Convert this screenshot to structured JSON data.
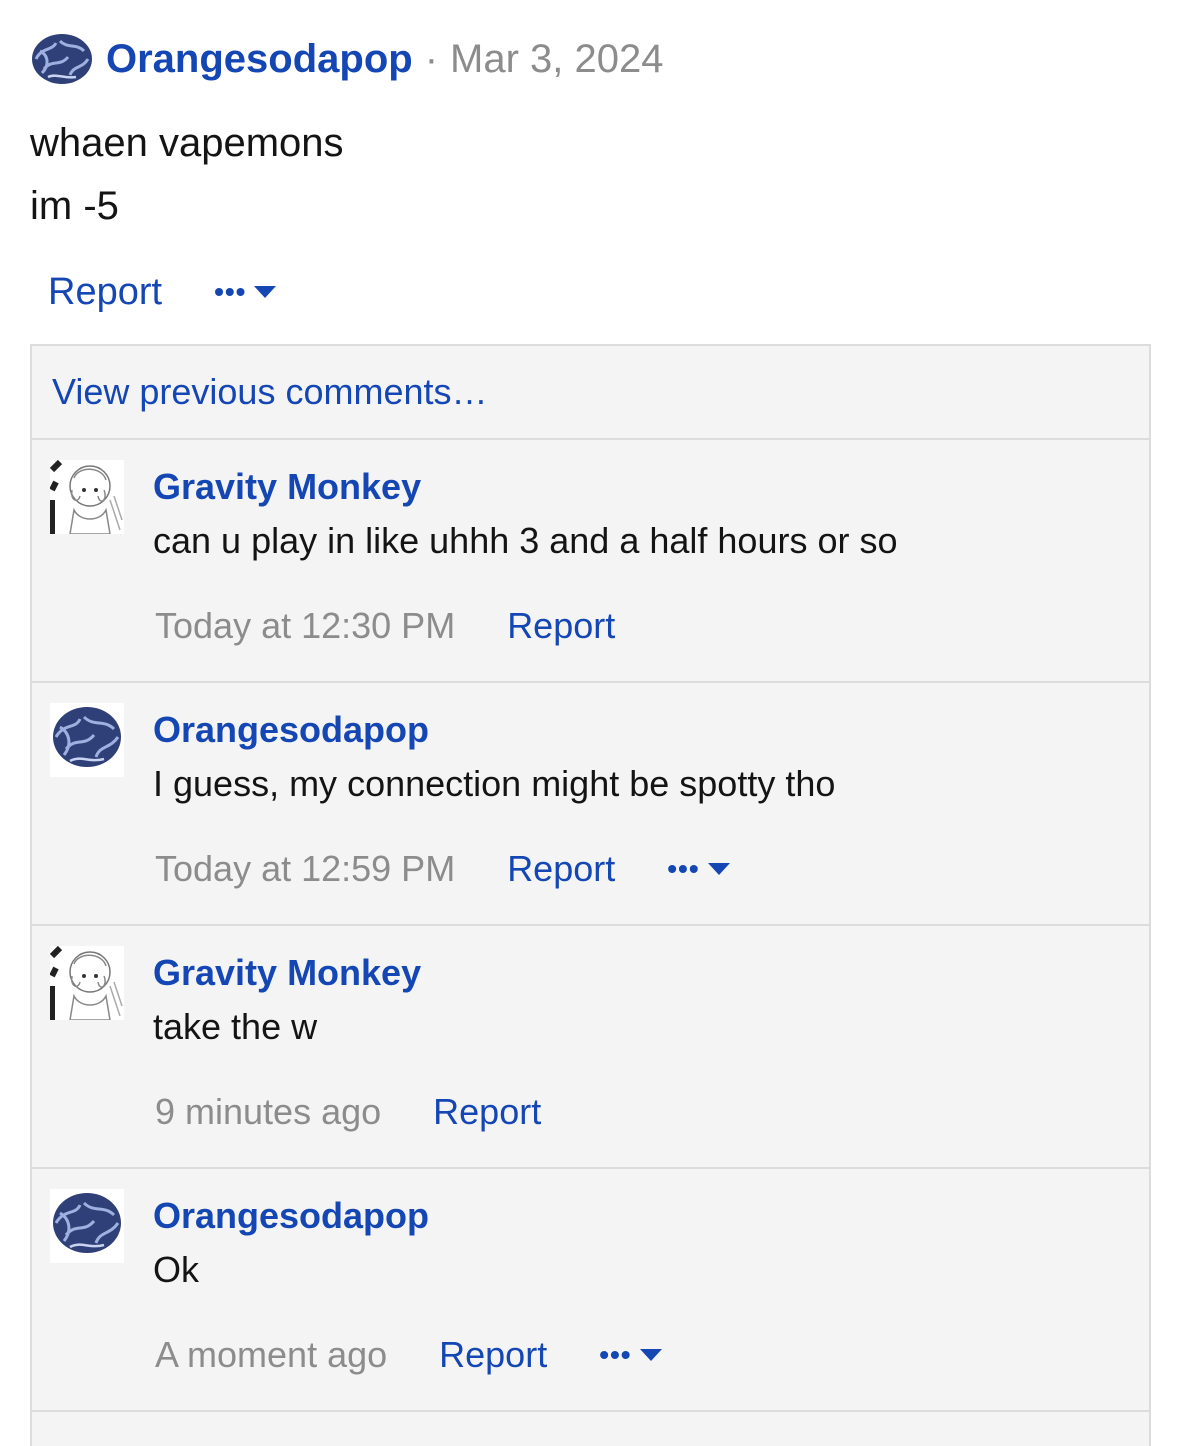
{
  "post": {
    "author": "Orangesodapop",
    "separator": "·",
    "date": "Mar 3, 2024",
    "body_lines": [
      "whaen vapemons",
      "im -5"
    ],
    "report_label": "Report",
    "more_label": "•••"
  },
  "comments_block": {
    "view_previous": "View previous comments…",
    "items": [
      {
        "author": "Gravity Monkey",
        "text": "can u play in like uhhh 3 and a half hours or so",
        "time": "Today at 12:30 PM",
        "report": "Report",
        "avatar": "girl-sketch"
      },
      {
        "author": "Orangesodapop",
        "text": "I guess, my connection might be spotty tho",
        "time": "Today at 12:59 PM",
        "report": "Report",
        "more": "•••",
        "avatar": "brain"
      },
      {
        "author": "Gravity Monkey",
        "text": "take the w",
        "time": "9 minutes ago",
        "report": "Report",
        "avatar": "girl-sketch"
      },
      {
        "author": "Orangesodapop",
        "text": "Ok",
        "time": "A moment ago",
        "report": "Report",
        "more": "•••",
        "avatar": "brain"
      }
    ]
  },
  "colors": {
    "link": "#1446b4",
    "muted": "#8c8c8c",
    "panel": "#f4f4f4",
    "border": "#dcdcdc"
  }
}
